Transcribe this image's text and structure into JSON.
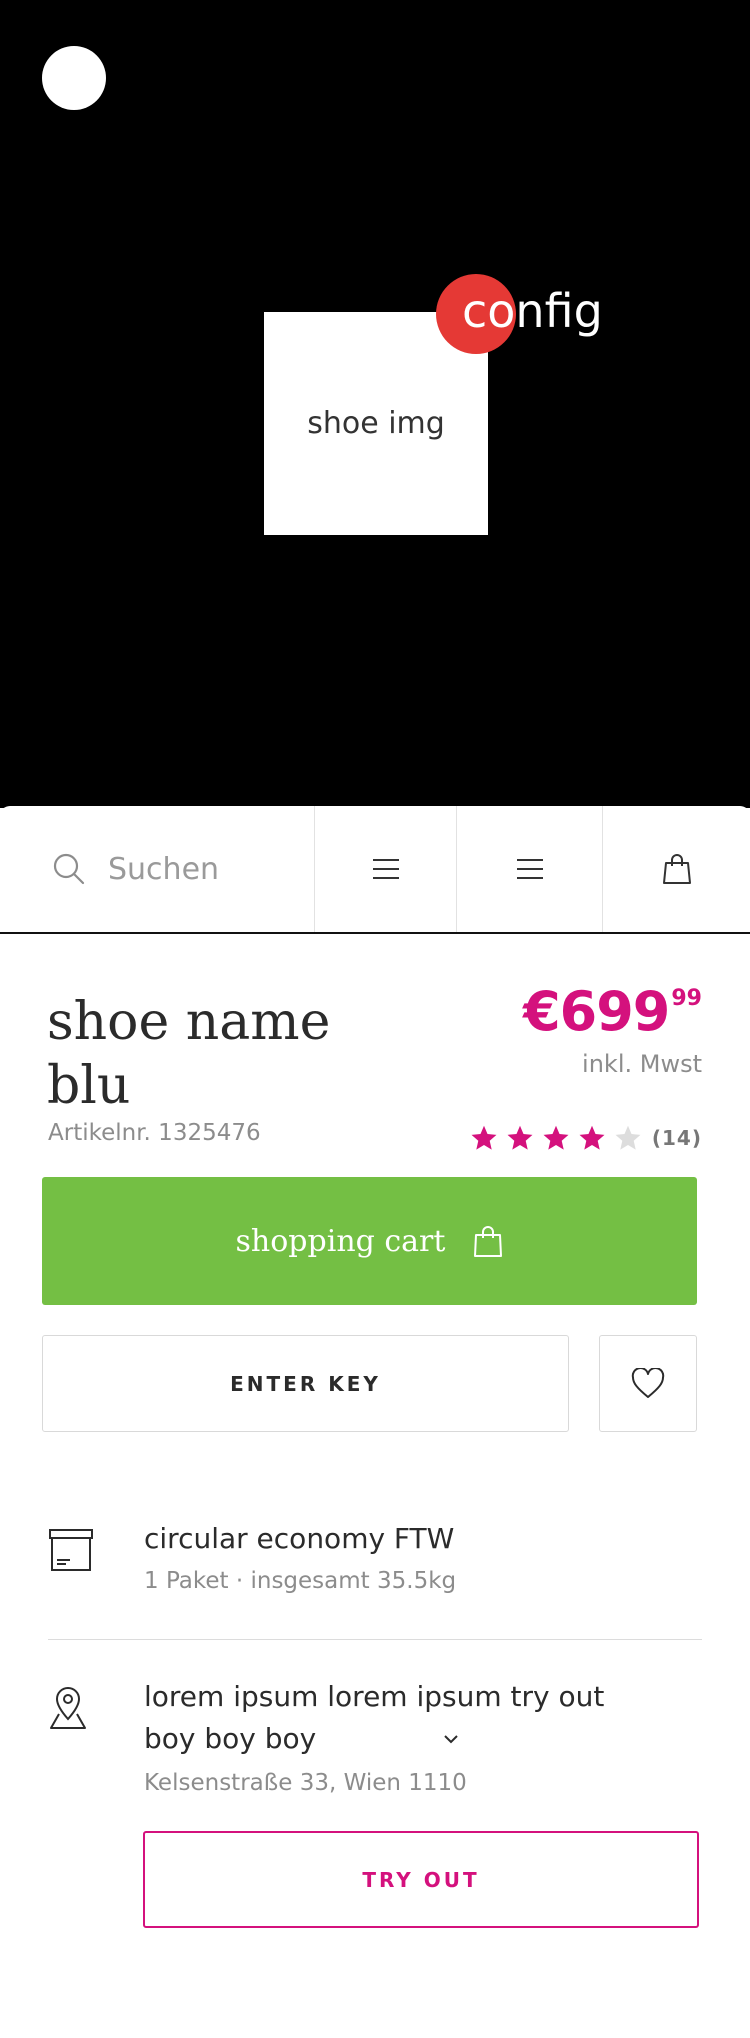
{
  "hero": {
    "placeholder_label": "shoe img",
    "config_label": "config"
  },
  "nav": {
    "search_placeholder": "Suchen"
  },
  "product": {
    "name": "shoe name blu",
    "price_main": "€699",
    "price_cents": "99",
    "vat_note": "inkl. Mwst",
    "article_number": "Artikelnr. 1325476",
    "rating": {
      "value": 4,
      "max": 5,
      "count_label": "(14)"
    }
  },
  "actions": {
    "cart_label": "shopping cart",
    "enter_key_label": "ENTER KEY"
  },
  "delivery": {
    "title": "circular economy FTW",
    "subtitle": "1 Paket · insgesamt 35.5kg"
  },
  "pickup": {
    "title_line1": "lorem ipsum lorem ipsum try out",
    "title_line2": "boy boy boy",
    "address": "Kelsenstraße 33, Wien 1110",
    "try_label": "TRY OUT"
  },
  "colors": {
    "accent": "#d4117d",
    "cart_green": "#74bf44",
    "config_red": "#e53935",
    "star_empty": "#dddddd"
  },
  "icons": {
    "search": "search-icon",
    "menu": "menu-icon",
    "bag": "shopping-bag-icon",
    "heart": "heart-icon",
    "package": "package-icon",
    "location": "location-pin-icon",
    "chevron": "chevron-down-icon"
  }
}
